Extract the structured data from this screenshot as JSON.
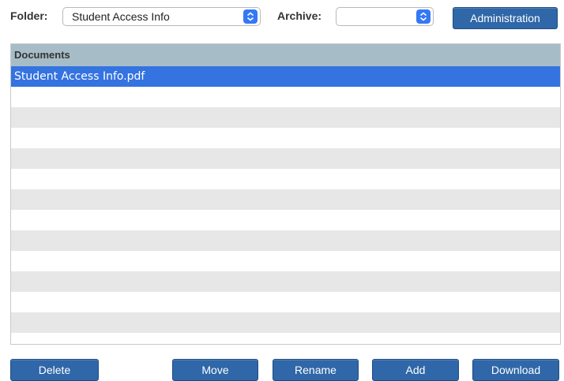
{
  "toolbar": {
    "folder_label": "Folder:",
    "folder_value": "Student Access Info",
    "archive_label": "Archive:",
    "archive_value": "",
    "administration_label": "Administration"
  },
  "documents": {
    "header": "Documents",
    "rows": [
      "Student Access Info.pdf",
      "",
      "",
      "",
      "",
      "",
      "",
      "",
      "",
      "",
      "",
      "",
      ""
    ]
  },
  "actions": {
    "delete_label": "Delete",
    "move_label": "Move",
    "rename_label": "Rename",
    "add_label": "Add",
    "download_label": "Download"
  },
  "colors": {
    "button": "#2f67a8",
    "header": "#a6bdc8",
    "selected_row": "#3473e0",
    "alt_row": "#e7e7e7"
  }
}
